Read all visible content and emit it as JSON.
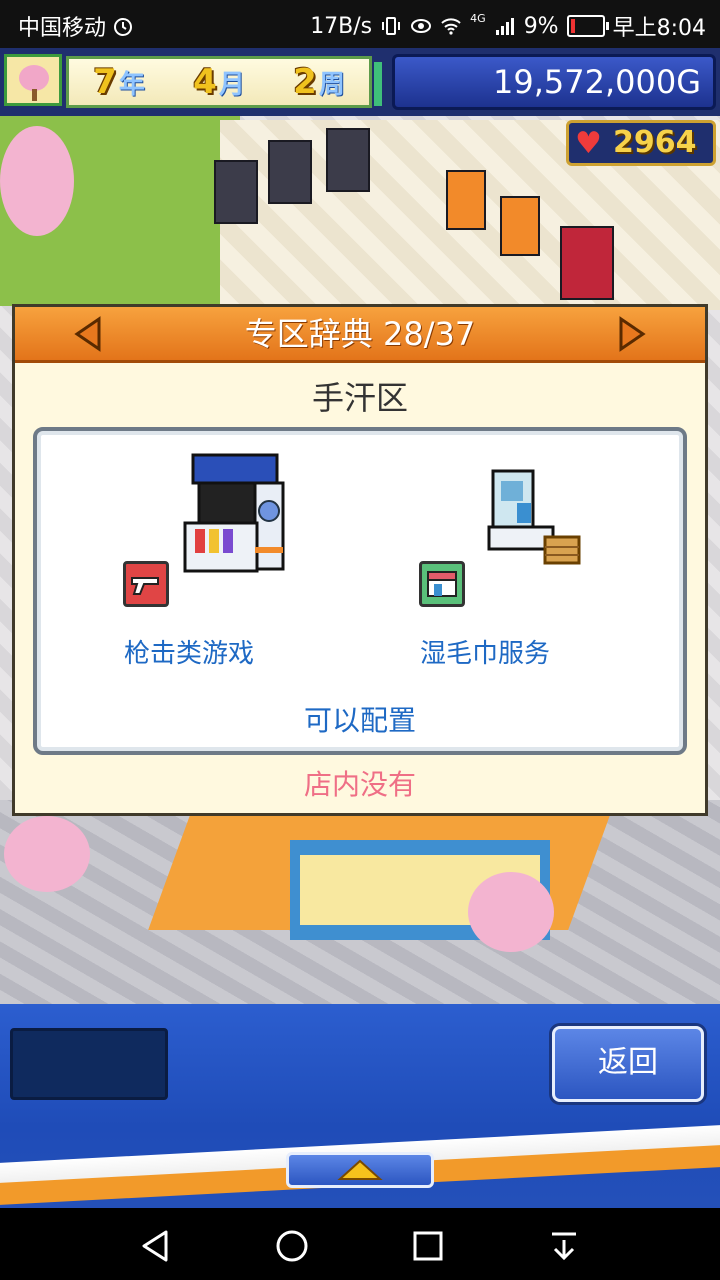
{
  "status_bar": {
    "carrier": "中国移动",
    "net_speed": "17B/s",
    "battery_percent": "9%",
    "time": "早上8:04",
    "network_tag": "4G"
  },
  "hud": {
    "year_num": "7",
    "year_unit": "年",
    "month_num": "4",
    "month_unit": "月",
    "week_num": "2",
    "week_unit": "周",
    "money": "19,572,000G",
    "hearts": "2964"
  },
  "dialog": {
    "title": "专区辞典 28/37",
    "area_name": "手汗区",
    "items": [
      {
        "label": "枪击类游戏",
        "icon": "gun-category-icon"
      },
      {
        "label": "湿毛巾服务",
        "icon": "service-category-icon"
      }
    ],
    "placeable_text": "可以配置",
    "status_text": "店内没有"
  },
  "bottom": {
    "back_label": "返回"
  },
  "colors": {
    "accent_orange": "#e3741a",
    "link_blue": "#1e69c4",
    "status_pink": "#ef6f86",
    "hud_blue": "#1f2f6e"
  }
}
